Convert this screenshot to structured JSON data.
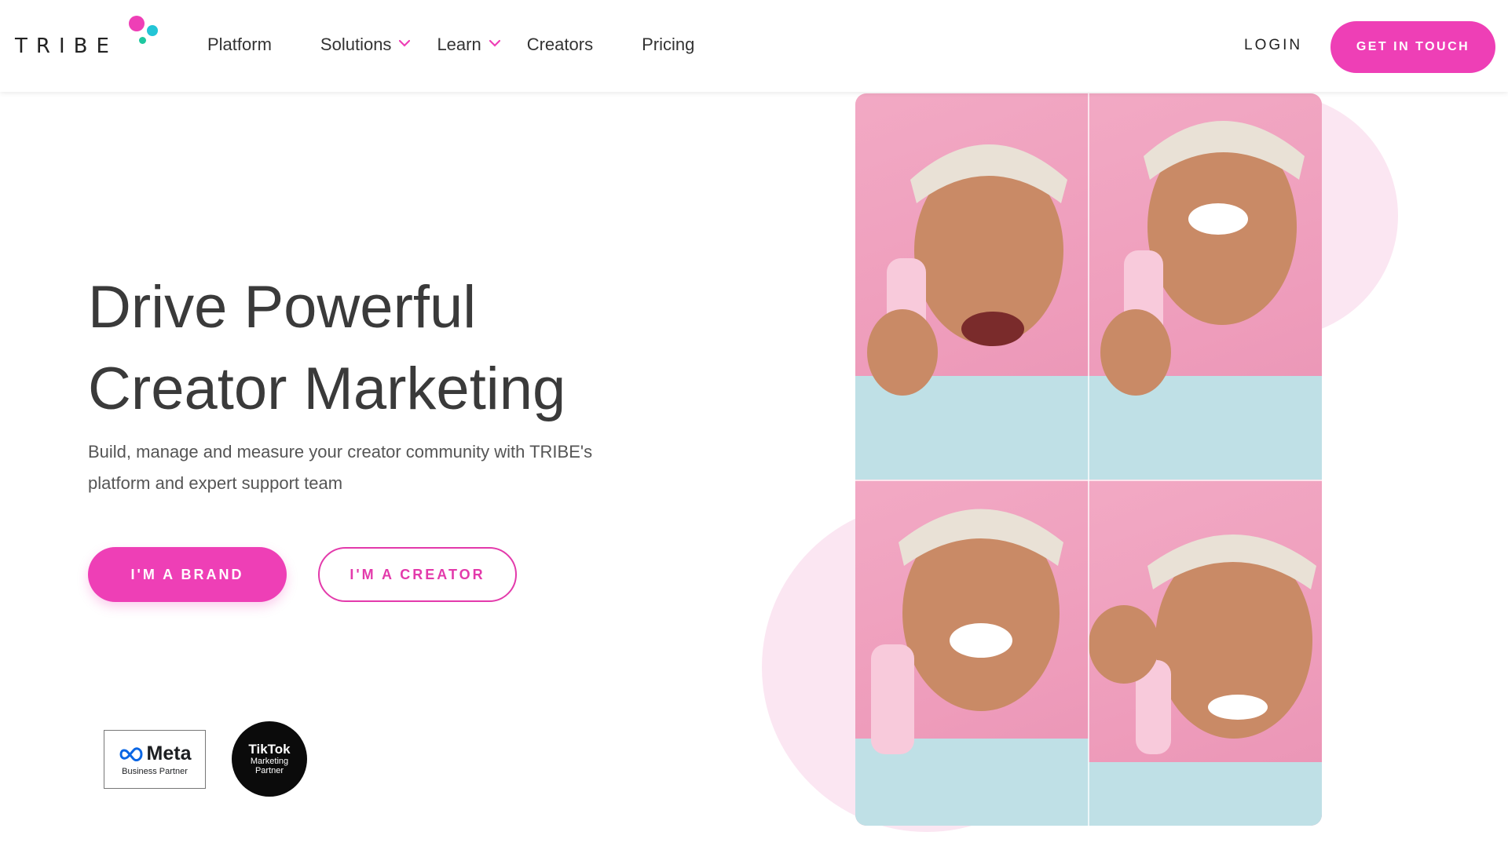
{
  "brand": {
    "logo_text": "TRIBE",
    "colors": {
      "accent": "#ee3fb6",
      "dot_pink": "#ee3fb6",
      "dot_teal": "#23c5d6",
      "dot_green": "#1ec8a0"
    }
  },
  "nav": {
    "items": [
      {
        "label": "Platform",
        "dropdown": false
      },
      {
        "label": "Solutions",
        "dropdown": true
      },
      {
        "label": "Learn",
        "dropdown": true
      },
      {
        "label": "Creators",
        "dropdown": false
      },
      {
        "label": "Pricing",
        "dropdown": false
      }
    ],
    "login_label": "LOGIN",
    "cta_label": "GET IN TOUCH"
  },
  "hero": {
    "title_line1": "Drive Powerful",
    "title_line2": "Creator Marketing",
    "subtitle_line1": "Build, manage and measure your creator community with TRIBE's",
    "subtitle_line2": "platform and expert support team",
    "primary_button": "I'M A BRAND",
    "secondary_button": "I'M A CREATOR"
  },
  "partners": {
    "meta_name": "Meta",
    "meta_sub": "Business Partner",
    "tiktok_name": "TikTok",
    "tiktok_sub_line1": "Marketing",
    "tiktok_sub_line2": "Partner"
  },
  "media": {
    "icon": "creator-photo-grid",
    "tiles": 4
  }
}
